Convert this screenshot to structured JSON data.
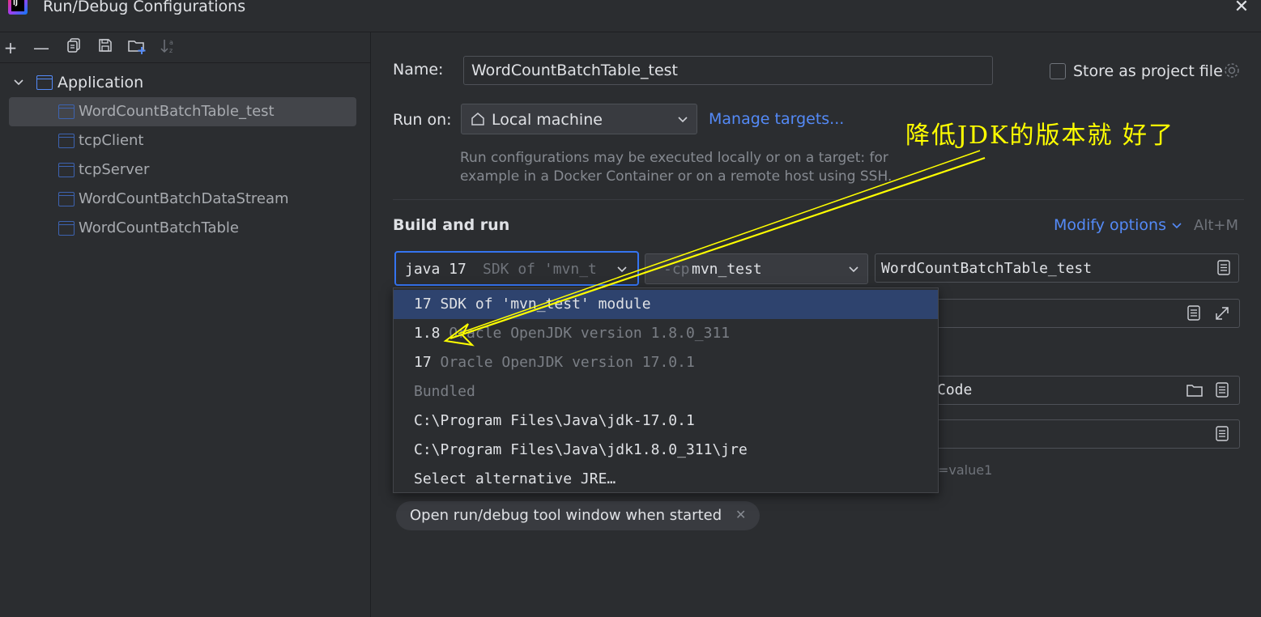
{
  "window": {
    "title": "Run/Debug Configurations",
    "logo_text": "IJ"
  },
  "toolbar": {
    "add": "+",
    "remove": "—"
  },
  "tree": {
    "group_label": "Application",
    "items": [
      {
        "label": "WordCountBatchTable_test",
        "selected": true
      },
      {
        "label": "tcpClient"
      },
      {
        "label": "tcpServer"
      },
      {
        "label": "WordCountBatchDataStream"
      },
      {
        "label": "WordCountBatchTable"
      }
    ]
  },
  "form": {
    "name_label": "Name:",
    "name_value": "WordCountBatchTable_test",
    "store_label": "Store as project file",
    "run_on_label": "Run on:",
    "run_on_value": "Local machine",
    "manage_targets": "Manage targets...",
    "run_on_hint_1": "Run configurations may be executed locally or on a target: for",
    "run_on_hint_2": "example in a Docker Container or on a remote host using SSH.",
    "section_title": "Build and run",
    "modify_options": "Modify options",
    "modify_shortcut": "Alt+M",
    "jre_value": "java 17",
    "jre_sub": "SDK of 'mvn_t",
    "classpath_prefix": "-cp",
    "classpath_value": "mvn_test",
    "main_class_value": "WordCountBatchTable_test",
    "workdir_partial": "Code",
    "env_hint_partial": "=value1",
    "tag_label": "Open run/debug tool window when started"
  },
  "jre_popup": {
    "items": [
      {
        "main": "17 SDK of 'mvn_test' module",
        "sub": "",
        "selected": true
      },
      {
        "main": "1.8",
        "sub": "Oracle OpenJDK version 1.8.0_311"
      },
      {
        "main": "17",
        "sub": "Oracle OpenJDK version 17.0.1"
      },
      {
        "main": "",
        "sub": "Bundled"
      },
      {
        "main": "C:\\Program Files\\Java\\jdk-17.0.1",
        "sub": ""
      },
      {
        "main": "C:\\Program Files\\Java\\jdk1.8.0_311\\jre",
        "sub": ""
      },
      {
        "main": "Select alternative JRE…",
        "sub": ""
      }
    ]
  },
  "annotation": {
    "text": "降低JDK的版本就 好了",
    "color": "#ffff00"
  },
  "colors": {
    "background": "#2b2d30",
    "accent": "#548af7",
    "selection": "#2e436e",
    "focus_border": "#3574f0"
  }
}
